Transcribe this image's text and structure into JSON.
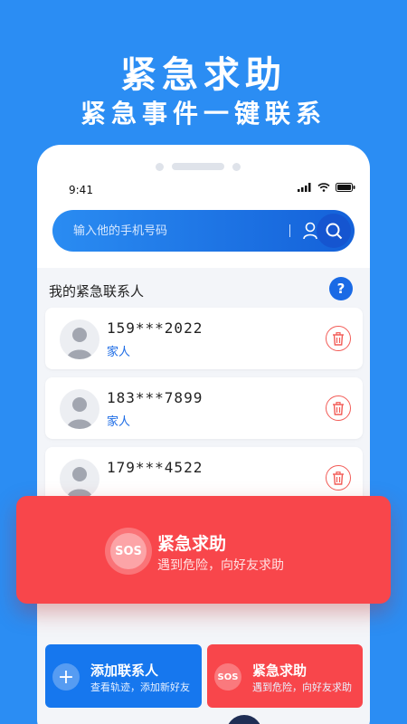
{
  "hero": {
    "title": "紧急求助",
    "subtitle": "紧急事件一键联系"
  },
  "status_bar": {
    "time": "9:41"
  },
  "search": {
    "placeholder": "输入他的手机号码"
  },
  "contacts_section": {
    "title": "我的紧急联系人",
    "help_label": "?"
  },
  "contacts": [
    {
      "phone": "159***2022",
      "relation": "家人"
    },
    {
      "phone": "183***7899",
      "relation": "家人"
    },
    {
      "phone": "179***4522",
      "relation": ""
    }
  ],
  "sos_banner": {
    "badge": "SOS",
    "title": "紧急求助",
    "subtitle": "遇到危险，向好友求助"
  },
  "actions": {
    "add": {
      "icon_label": "+",
      "title": "添加联系人",
      "subtitle": "查看轨迹，添加新好友"
    },
    "sos": {
      "badge": "SOS",
      "title": "紧急求助",
      "subtitle": "遇到危险，向好友求助"
    }
  },
  "colors": {
    "background": "#2b8df3",
    "primary": "#1a6ae5",
    "danger": "#f8464b"
  },
  "icons": {
    "signal": "signal-icon",
    "wifi": "wifi-icon",
    "battery": "battery-icon",
    "contact": "contact-icon",
    "search": "search-icon",
    "trash": "trash-icon"
  }
}
